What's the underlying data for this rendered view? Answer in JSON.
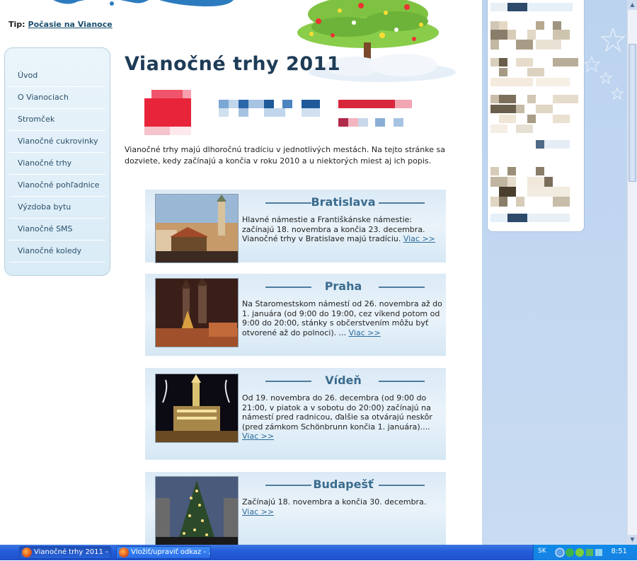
{
  "tip": {
    "label": "Tip:",
    "link": "Počasie na Vianoce"
  },
  "nav": {
    "items": [
      "Úvod",
      "O Vianociach",
      "Stromček",
      "Vianočné cukrovinky",
      "Vianočné trhy",
      "Vianočné pohľadnice",
      "Výzdoba bytu",
      "Vianočné SMS",
      "Vianočné koledy"
    ]
  },
  "main": {
    "title": "Vianočné trhy 2011",
    "intro": "Vianočné trhy majú dlhoročnú tradíciu v jednotlivých mestách. Na tejto stránke sa dozviete, kedy začínajú a končia v roku 2010 a u niektorých miest aj ich popis."
  },
  "cards": [
    {
      "city": "Bratislava",
      "desc": "Hlavné námestie a Františkánske námestie: začínajú 18. novembra a končia 23. decembra. Vianočné trhy v Bratislave majú tradíciu.",
      "more": "Viac >>"
    },
    {
      "city": "Praha",
      "desc": "Na Staromestskom námestí od 26. novembra až do 1. januára (od 9:00 do 19:00, cez víkend potom od 9:00 do 20:00, stánky s občerstvením môžu byť otvorené až do polnoci). ...",
      "more": "Viac >>"
    },
    {
      "city": "Vídeň",
      "desc": "Od 19. novembra do 26. decembra (od 9:00 do 21:00, v piatok a v sobotu do 20:00) začínajú na námestí pred radnicou, ďalšie sa otvárajú neskôr (pred zámkom Schönbrunn končia 1. januára)....",
      "more": "Viac >>"
    },
    {
      "city": "Budapešť",
      "desc": "Začínajú 18. novembra a končia 30. decembra.",
      "more": "Viac >>"
    }
  ],
  "taskbar": {
    "buttons": [
      "Vianočné trhy 2011 - ...",
      "Vložiť/upraviť odkaz - ..."
    ],
    "lang": "SK",
    "time": "8:51"
  },
  "colors": {
    "accent": "#3b6c8e",
    "title": "#1e3c57",
    "sidebar_right": "#bcd3ef",
    "taskbar": "#245edb"
  }
}
